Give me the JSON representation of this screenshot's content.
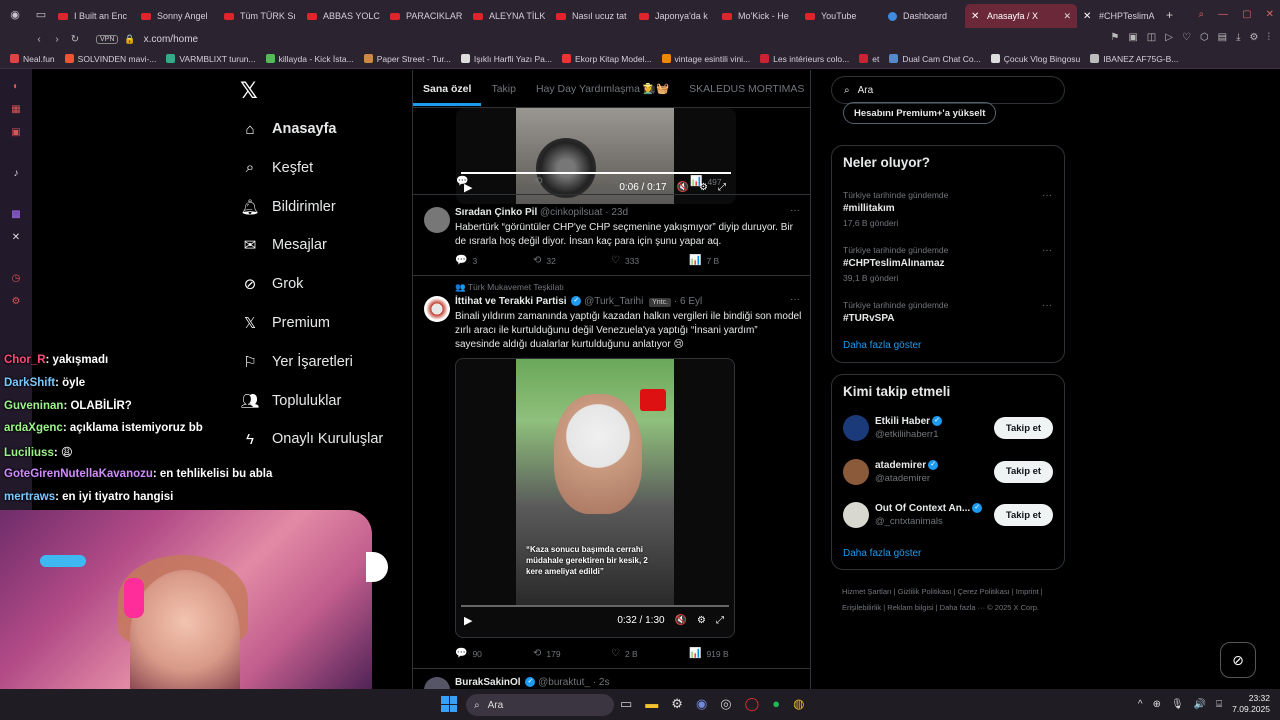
{
  "browser": {
    "tabs": [
      {
        "label": "I Built an Enc",
        "icon": "youtube-icon"
      },
      {
        "label": "Sonny Angel",
        "icon": "youtube-icon"
      },
      {
        "label": "Tüm TÜRK Sı",
        "icon": "youtube-icon"
      },
      {
        "label": "ABBAS YOLC",
        "icon": "youtube-icon"
      },
      {
        "label": "PARACIKLAR",
        "icon": "youtube-icon"
      },
      {
        "label": "ALEYNA TİLK",
        "icon": "youtube-icon"
      },
      {
        "label": "Nasıl ucuz tat",
        "icon": "youtube-icon"
      },
      {
        "label": "Japonya'da k",
        "icon": "youtube-icon"
      },
      {
        "label": "Mo'Kick - He",
        "icon": "youtube-icon"
      },
      {
        "label": "YouTube",
        "icon": "youtube-icon"
      },
      {
        "label": "Dashboard",
        "icon": "dashboard-icon"
      },
      {
        "label": "Anasayfa / X",
        "icon": "x-icon",
        "active": true
      },
      {
        "label": "#CHPTeslimA",
        "icon": "x-icon"
      }
    ],
    "url": "x.com/home",
    "vpn_label": "VPN",
    "bookmarks": [
      "Neal.fun",
      "SOLVINDEN mavi-...",
      "VARMBLIXT turun...",
      "killayda - Kick İsta...",
      "Paper Street - Tur...",
      "Işıklı Harfli Yazı Pa...",
      "Ekorp Kitap Model...",
      "vintage esintili vini...",
      "Les intérieurs colo...",
      "et",
      "Dual Cam Chat Co...",
      "Çocuk Vlog Bingosu",
      "IBANEZ AF75G-B..."
    ]
  },
  "x_nav": {
    "items": [
      {
        "label": "Anasayfa",
        "icon": "home-icon",
        "active": true
      },
      {
        "label": "Keşfet",
        "icon": "search-icon"
      },
      {
        "label": "Bildirimler",
        "icon": "bell-icon"
      },
      {
        "label": "Mesajlar",
        "icon": "mail-icon"
      },
      {
        "label": "Grok",
        "icon": "grok-icon"
      },
      {
        "label": "Premium",
        "icon": "x-icon"
      },
      {
        "label": "Yer İşaretleri",
        "icon": "bookmark-icon"
      },
      {
        "label": "Topluluklar",
        "icon": "people-icon"
      },
      {
        "label": "Onaylı Kuruluşlar",
        "icon": "lightning-icon"
      }
    ]
  },
  "feed": {
    "tabs": [
      "Sana özel",
      "Takip",
      "Hay Day Yardımlaşma 👩‍🌾🧺",
      "SKALEDUS MORTIMAS"
    ],
    "video1": {
      "time": "0:06 / 0:17",
      "stats": {
        "reply": "",
        "repost": "",
        "like": "1",
        "views": "497"
      }
    },
    "post1": {
      "name": "Sıradan Çinko Pil",
      "handle": "@cinkopilsuat",
      "time": "23d",
      "text": "Habertürk “görüntüler CHP'ye CHP seçmenine yakışmıyor” diyip duruyor. Bir de ısrarla hoş değil diyor. İnsan kaç para için şunu yapar aq.",
      "stats": {
        "reply": "3",
        "repost": "32",
        "like": "333",
        "views": "7 B"
      }
    },
    "post2": {
      "context": "Türk Mukavemet Teşkilatı",
      "name": "İttihat ve Terakki Partisi",
      "handle": "@Turk_Tarihi",
      "badge": "Yntc.",
      "time": "6 Eyl",
      "text": "Binali yıldırım zamanında yaptığı kazadan halkın vergileri ile bindiği son model zırlı aracı ile kurtulduğunu değil Venezuela'ya yaptığı “İnsani yardım” sayesinde aldığı dualarlar kurtulduğunu anlatıyor 😢",
      "video_caption": "“Kaza sonucu başımda cerrahi müdahale gerektiren bir kesik, 2 kere ameliyat edildi”",
      "video_time": "0:32 / 1:30",
      "stats": {
        "reply": "90",
        "repost": "179",
        "like": "2 B",
        "views": "919 B"
      }
    },
    "post3": {
      "name": "BurakSakinOl",
      "handle": "@buraktut_",
      "time": "2s"
    }
  },
  "right": {
    "search_placeholder": "Ara",
    "premium_button": "Hesabını Premium+'a yükselt",
    "trends_title": "Neler oluyor?",
    "trends": [
      {
        "meta": "Türkiye tarihinde gündemde",
        "name": "#millitakım",
        "count": "17,6 B gönderi"
      },
      {
        "meta": "Türkiye tarihinde gündemde",
        "name": "#CHPTeslimAlınamaz",
        "count": "39,1 B gönderi"
      },
      {
        "meta": "Türkiye tarihinde gündemde",
        "name": "#TURvSPA",
        "count": ""
      }
    ],
    "show_more": "Daha fazla göster",
    "who_title": "Kimi takip etmeli",
    "who": [
      {
        "name": "Etkili Haber",
        "handle": "@etkiliihaberr1",
        "button": "Takip et",
        "avatar_color": "#1b3a7a"
      },
      {
        "name": "atademirer",
        "handle": "@atademirer",
        "button": "Takip et",
        "avatar_color": "#8a5a3a"
      },
      {
        "name": "Out Of Context An...",
        "handle": "@_cntxtanimals",
        "button": "Takip et",
        "avatar_color": "#d8d8d0"
      }
    ],
    "footer": "Hizmet Şartları  |  Gizlilik Politikası  |  Çerez Politikası  |  Imprint  |  Erişilebilirlik  |  Reklam bilgisi  |  Daha fazla ···  © 2025 X Corp."
  },
  "chat": [
    {
      "user": "Chor_R",
      "msg": ": yakışmadı",
      "color": "#ff4a7a"
    },
    {
      "user": "DarkShift",
      "msg": ": öyle",
      "color": "#7ac8ff"
    },
    {
      "user": "Guveninan",
      "msg": ": OLABİLİR?",
      "color": "#9cf58a"
    },
    {
      "user": "ardaXgenc",
      "msg": ": açıklama istemiyoruz bb",
      "color": "#9cf58a"
    },
    {
      "user": "Luciliuss",
      "msg": ": 😩",
      "color": "#9cf58a"
    },
    {
      "user": "GoteGirenNutellaKavanozu",
      "msg": ": en tehlikelisi bu abla",
      "color": "#d08cff"
    },
    {
      "user": "mertraws",
      "msg": ": en iyi tiyatro hangisi",
      "color": "#7ac8ff"
    }
  ],
  "taskbar": {
    "search_label": "Ara",
    "time": "23:32",
    "date": "7.09.2025"
  }
}
